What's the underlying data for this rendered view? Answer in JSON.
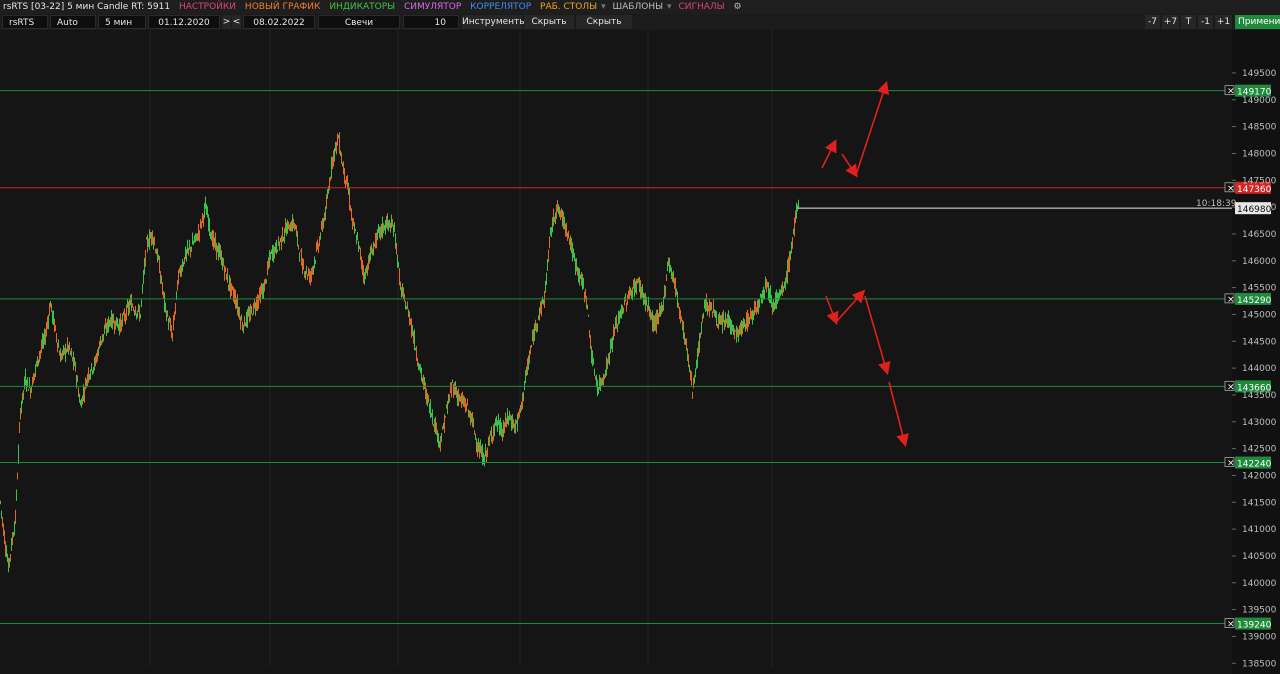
{
  "menu": {
    "instrument_title": "rsRTS [03-22] 5 мин Candle RT: 5911",
    "items": [
      {
        "label": "НАСТРОЙКИ",
        "color": "#e0407a"
      },
      {
        "label": "НОВЫЙ ГРАФИК",
        "color": "#f07d2a"
      },
      {
        "label": "ИНДИКАТОРЫ",
        "color": "#3cc24a"
      },
      {
        "label": "СИМУЛЯТОР",
        "color": "#d86be8"
      },
      {
        "label": "КОРРЕЛЯТОР",
        "color": "#3f8ee8"
      },
      {
        "label": "РАБ. СТОЛЫ",
        "color": "#f0a22a"
      },
      {
        "label": "ШАБЛОНЫ",
        "color": "#bdbdbd"
      },
      {
        "label": "СИГНАЛЫ",
        "color": "#e0407a"
      }
    ],
    "gear_icon": "gear-icon"
  },
  "toolbar": {
    "ticker": "rsRTS",
    "scale": "Auto",
    "timeframe": "5 мин",
    "date_from": "01.12.2020",
    "date_to": "08.02.2022",
    "chart_type": "Свечи",
    "count": "10",
    "instruments": "Инструменты",
    "hide_drawings": "Скрыть рис.",
    "hide_lines": "Скрыть линии",
    "zoom_buttons": [
      "-7",
      "+7",
      "T",
      "-1",
      "+1"
    ],
    "apply": "Применить"
  },
  "chart_data": {
    "type": "candlestick",
    "ylim": [
      138300,
      150300
    ],
    "y_ticks": [
      138500,
      139000,
      139500,
      140000,
      140500,
      141000,
      141500,
      142000,
      142500,
      143000,
      143500,
      144000,
      144500,
      145000,
      145500,
      146000,
      146500,
      147000,
      147500,
      148000,
      148500,
      149000,
      149500
    ],
    "current_price": 146980,
    "current_time": "10:18:39",
    "levels": [
      {
        "value": 149170,
        "color": "#1f8a3b"
      },
      {
        "value": 147360,
        "color": "#d42525"
      },
      {
        "value": 145290,
        "color": "#1f8a3b"
      },
      {
        "value": 143660,
        "color": "#1f8a3b"
      },
      {
        "value": 142240,
        "color": "#1f8a3b"
      },
      {
        "value": 139240,
        "color": "#1f8a3b"
      }
    ],
    "price_path": [
      [
        0,
        141500
      ],
      [
        3,
        141000
      ],
      [
        8,
        140300
      ],
      [
        15,
        141200
      ],
      [
        20,
        143200
      ],
      [
        25,
        143800
      ],
      [
        30,
        143600
      ],
      [
        38,
        144200
      ],
      [
        45,
        144600
      ],
      [
        50,
        145200
      ],
      [
        55,
        144700
      ],
      [
        60,
        144200
      ],
      [
        68,
        144400
      ],
      [
        75,
        144000
      ],
      [
        80,
        143300
      ],
      [
        88,
        143900
      ],
      [
        95,
        144100
      ],
      [
        100,
        144500
      ],
      [
        110,
        144900
      ],
      [
        120,
        144800
      ],
      [
        130,
        145200
      ],
      [
        140,
        145000
      ],
      [
        146,
        146300
      ],
      [
        152,
        146500
      ],
      [
        158,
        146000
      ],
      [
        165,
        145100
      ],
      [
        172,
        144600
      ],
      [
        178,
        145700
      ],
      [
        185,
        146100
      ],
      [
        192,
        146300
      ],
      [
        198,
        146500
      ],
      [
        205,
        147000
      ],
      [
        212,
        146400
      ],
      [
        220,
        146100
      ],
      [
        228,
        145600
      ],
      [
        235,
        145300
      ],
      [
        242,
        144800
      ],
      [
        250,
        145000
      ],
      [
        258,
        145300
      ],
      [
        264,
        145500
      ],
      [
        270,
        146100
      ],
      [
        278,
        146300
      ],
      [
        286,
        146600
      ],
      [
        294,
        146700
      ],
      [
        302,
        145900
      ],
      [
        310,
        145700
      ],
      [
        318,
        146300
      ],
      [
        326,
        147000
      ],
      [
        332,
        147900
      ],
      [
        338,
        148300
      ],
      [
        342,
        147800
      ],
      [
        348,
        147300
      ],
      [
        352,
        146700
      ],
      [
        358,
        146300
      ],
      [
        364,
        145700
      ],
      [
        370,
        146100
      ],
      [
        378,
        146500
      ],
      [
        386,
        146700
      ],
      [
        394,
        146600
      ],
      [
        400,
        145500
      ],
      [
        405,
        145200
      ],
      [
        410,
        144900
      ],
      [
        418,
        144100
      ],
      [
        426,
        143500
      ],
      [
        432,
        143100
      ],
      [
        440,
        142600
      ],
      [
        446,
        143200
      ],
      [
        452,
        143700
      ],
      [
        460,
        143400
      ],
      [
        466,
        143300
      ],
      [
        472,
        143000
      ],
      [
        478,
        142500
      ],
      [
        484,
        142300
      ],
      [
        490,
        142700
      ],
      [
        496,
        143000
      ],
      [
        502,
        142800
      ],
      [
        508,
        143100
      ],
      [
        515,
        142900
      ],
      [
        520,
        143200
      ],
      [
        526,
        143900
      ],
      [
        532,
        144500
      ],
      [
        538,
        145000
      ],
      [
        544,
        145300
      ],
      [
        550,
        146500
      ],
      [
        556,
        147000
      ],
      [
        562,
        146800
      ],
      [
        568,
        146500
      ],
      [
        574,
        146000
      ],
      [
        580,
        145700
      ],
      [
        586,
        145300
      ],
      [
        592,
        144100
      ],
      [
        598,
        143600
      ],
      [
        606,
        144000
      ],
      [
        614,
        144700
      ],
      [
        622,
        145100
      ],
      [
        630,
        145400
      ],
      [
        638,
        145600
      ],
      [
        646,
        145200
      ],
      [
        654,
        144800
      ],
      [
        662,
        145100
      ],
      [
        668,
        146000
      ],
      [
        674,
        145600
      ],
      [
        680,
        145000
      ],
      [
        686,
        144400
      ],
      [
        692,
        143600
      ],
      [
        698,
        144300
      ],
      [
        704,
        145200
      ],
      [
        712,
        145100
      ],
      [
        720,
        144800
      ],
      [
        728,
        144900
      ],
      [
        736,
        144600
      ],
      [
        744,
        144800
      ],
      [
        752,
        145000
      ],
      [
        760,
        145300
      ],
      [
        766,
        145600
      ],
      [
        772,
        145200
      ],
      [
        778,
        145300
      ],
      [
        784,
        145500
      ],
      [
        790,
        146100
      ],
      [
        795,
        146800
      ],
      [
        798,
        146980
      ]
    ]
  }
}
